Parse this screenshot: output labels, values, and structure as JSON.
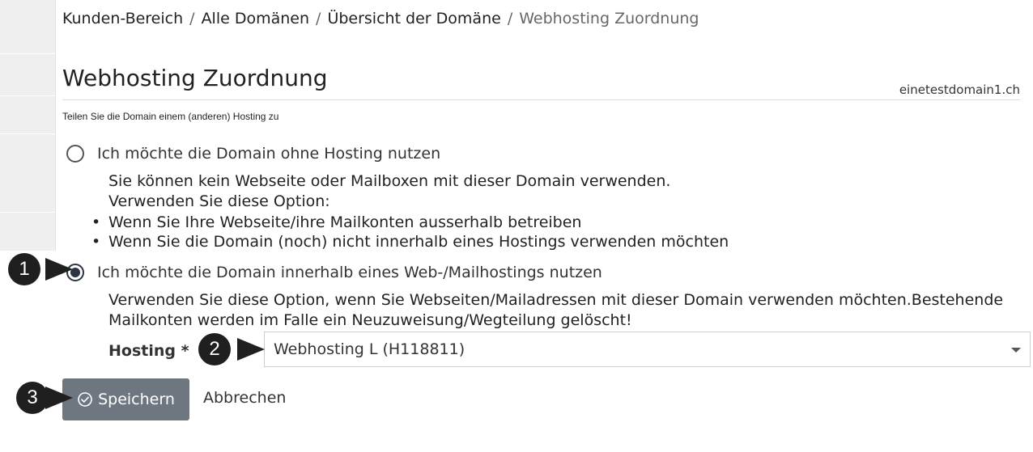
{
  "breadcrumb": {
    "items": [
      "Kunden-Bereich",
      "Alle Domänen",
      "Übersicht der Domäne"
    ],
    "current": "Webhosting Zuordnung",
    "separator": "/"
  },
  "page": {
    "title": "Webhosting Zuordnung",
    "domain": "einetestdomain1.ch",
    "subtitle": "Teilen Sie die Domain einem (anderen) Hosting zu"
  },
  "options": {
    "no_hosting": {
      "label": "Ich möchte die Domain ohne Hosting nutzen",
      "checked": false,
      "desc_line1": "Sie können kein Webseite oder Mailboxen mit dieser Domain verwenden.",
      "desc_line2": "Verwenden Sie diese Option:",
      "bullets": [
        "Wenn Sie Ihre Webseite/ihre Mailkonten ausserhalb betreiben",
        "Wenn Sie die Domain (noch) nicht innerhalb eines Hostings verwenden möchten"
      ]
    },
    "with_hosting": {
      "label": "Ich möchte die Domain innerhalb eines Web-/Mailhostings nutzen",
      "checked": true,
      "desc_line1": "Verwenden Sie diese Option, wenn Sie Webseiten/Mailadressen mit dieser Domain verwenden möchten.Bestehende",
      "desc_line2": "Mailkonten werden im Falle ein Neuzuweisung/Wegteilung gelöscht!"
    }
  },
  "hosting_field": {
    "label": "Hosting *",
    "selected": "Webhosting L (H118811)"
  },
  "actions": {
    "save_label": "Speichern",
    "cancel_label": "Abbrechen"
  },
  "callouts": [
    "1",
    "2",
    "3"
  ],
  "colors": {
    "primary_button": "#6e7780",
    "callout": "#1f1f1f",
    "sidebar": "#efefef"
  },
  "icons": {
    "save": "check-circle-icon",
    "select": "caret-down-icon",
    "radio": "radio-icon"
  }
}
